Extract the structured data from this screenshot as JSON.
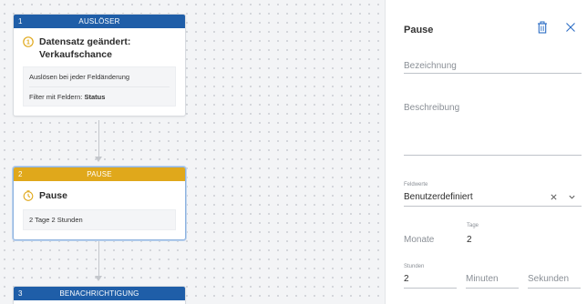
{
  "workflow": {
    "nodes": [
      {
        "number": "1",
        "header": "AUSLÖSER",
        "title_line1": "Datensatz geändert:",
        "title_line2": "Verkaufschance",
        "info": [
          "Auslösen bei jeder Feldänderung"
        ],
        "filter_label": "Filter mit Feldern: ",
        "filter_value": "Status",
        "header_color": "#1f5ea8",
        "icon": "trigger-number-icon"
      },
      {
        "number": "2",
        "header": "PAUSE",
        "title": "Pause",
        "info": [
          "2 Tage 2 Stunden"
        ],
        "header_color": "#e0a81b",
        "icon": "timer-icon"
      },
      {
        "number": "3",
        "header": "BENACHRICHTIGUNG",
        "header_color": "#1f5ea8"
      }
    ]
  },
  "panel": {
    "title": "Pause",
    "name_placeholder": "Bezeichnung",
    "description_placeholder": "Beschreibung",
    "field_values_label": "Feldwerte",
    "field_values_value": "Benutzerdefiniert",
    "months_label": "Monate",
    "days_label": "Tage",
    "days_value": "2",
    "hours_label": "Stunden",
    "hours_value": "2",
    "minutes_placeholder": "Minuten",
    "seconds_placeholder": "Sekunden"
  },
  "colors": {
    "accent_blue": "#1f5ea8",
    "accent_yellow": "#e0a81b",
    "icon_blue": "#2a6cc4"
  }
}
